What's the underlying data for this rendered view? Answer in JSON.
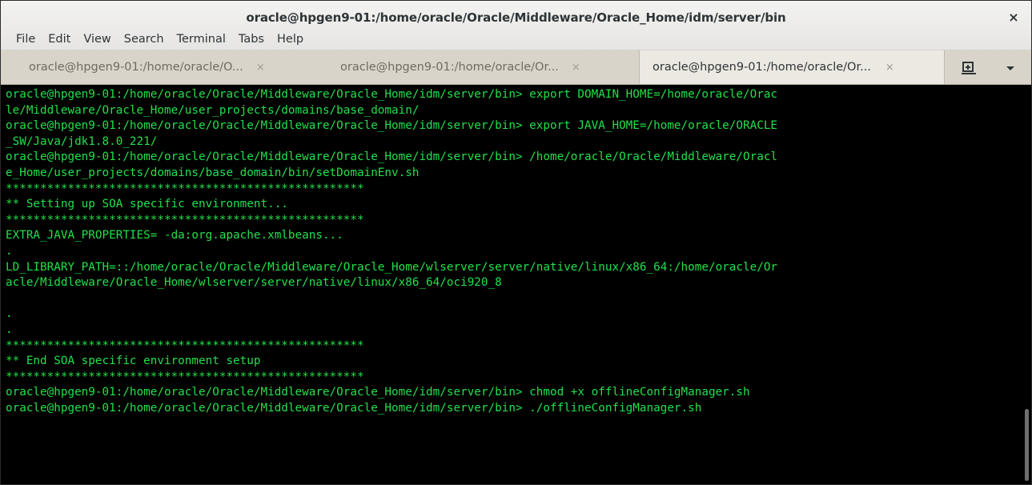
{
  "window": {
    "title": "oracle@hpgen9-01:/home/oracle/Oracle/Middleware/Oracle_Home/idm/server/bin",
    "close_glyph": "×"
  },
  "menu": {
    "items": [
      "File",
      "Edit",
      "View",
      "Search",
      "Terminal",
      "Tabs",
      "Help"
    ]
  },
  "tabs": [
    {
      "label": "oracle@hpgen9-01:/home/oracle/O...",
      "close": "×",
      "active": false
    },
    {
      "label": "oracle@hpgen9-01:/home/oracle/Or...",
      "close": "×",
      "active": false
    },
    {
      "label": "oracle@hpgen9-01:/home/oracle/Or...",
      "close": "×",
      "active": true
    }
  ],
  "tabbar_icons": {
    "new_tab": "new-tab-icon",
    "dropdown": "chevron-down-icon"
  },
  "colors": {
    "terminal_bg": "#000000",
    "terminal_fg": "#21e04a",
    "tab_bg": "#d8d4ca",
    "active_tab_bg": "#ece9e3"
  },
  "terminal": {
    "lines": [
      "oracle@hpgen9-01:/home/oracle/Oracle/Middleware/Oracle_Home/idm/server/bin> export DOMAIN_HOME=/home/oracle/Orac",
      "le/Middleware/Oracle_Home/user_projects/domains/base_domain/",
      "oracle@hpgen9-01:/home/oracle/Oracle/Middleware/Oracle_Home/idm/server/bin> export JAVA_HOME=/home/oracle/ORACLE",
      "_SW/Java/jdk1.8.0_221/",
      "oracle@hpgen9-01:/home/oracle/Oracle/Middleware/Oracle_Home/idm/server/bin> /home/oracle/Oracle/Middleware/Oracl",
      "e_Home/user_projects/domains/base_domain/bin/setDomainEnv.sh",
      "****************************************************",
      "** Setting up SOA specific environment...",
      "****************************************************",
      "EXTRA_JAVA_PROPERTIES= -da:org.apache.xmlbeans...",
      ".",
      "LD_LIBRARY_PATH=::/home/oracle/Oracle/Middleware/Oracle_Home/wlserver/server/native/linux/x86_64:/home/oracle/Or",
      "acle/Middleware/Oracle_Home/wlserver/server/native/linux/x86_64/oci920_8",
      "",
      ".",
      ".",
      "****************************************************",
      "** End SOA specific environment setup",
      "****************************************************",
      "oracle@hpgen9-01:/home/oracle/Oracle/Middleware/Oracle_Home/idm/server/bin> chmod +x offlineConfigManager.sh",
      "oracle@hpgen9-01:/home/oracle/Oracle/Middleware/Oracle_Home/idm/server/bin> ./offlineConfigManager.sh"
    ]
  }
}
